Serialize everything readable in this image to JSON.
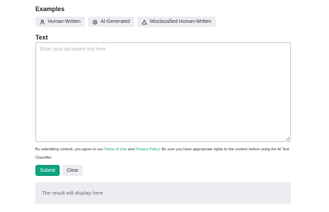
{
  "examples": {
    "title": "Examples",
    "chips": [
      {
        "label": "Human-Written",
        "icon": "person-icon"
      },
      {
        "label": "AI-Generated",
        "icon": "openai-logo-icon"
      },
      {
        "label": "Misclassified Human-Written",
        "icon": "warning-icon"
      }
    ]
  },
  "text_section": {
    "title": "Text",
    "placeholder": "Enter your document text here"
  },
  "disclaimer": {
    "prefix": "By submitting content, you agree to our ",
    "terms_link": "Terms of Use",
    "and": " and ",
    "privacy_link": "Privacy Policy",
    "suffix": ". Be sure you have appropriate rights to the content before using the AI Text Classifier."
  },
  "buttons": {
    "submit": "Submit",
    "clear": "Clear"
  },
  "result": {
    "placeholder": "The result will display here."
  },
  "colors": {
    "accent": "#10a37f",
    "chip_bg": "#ececf1"
  }
}
